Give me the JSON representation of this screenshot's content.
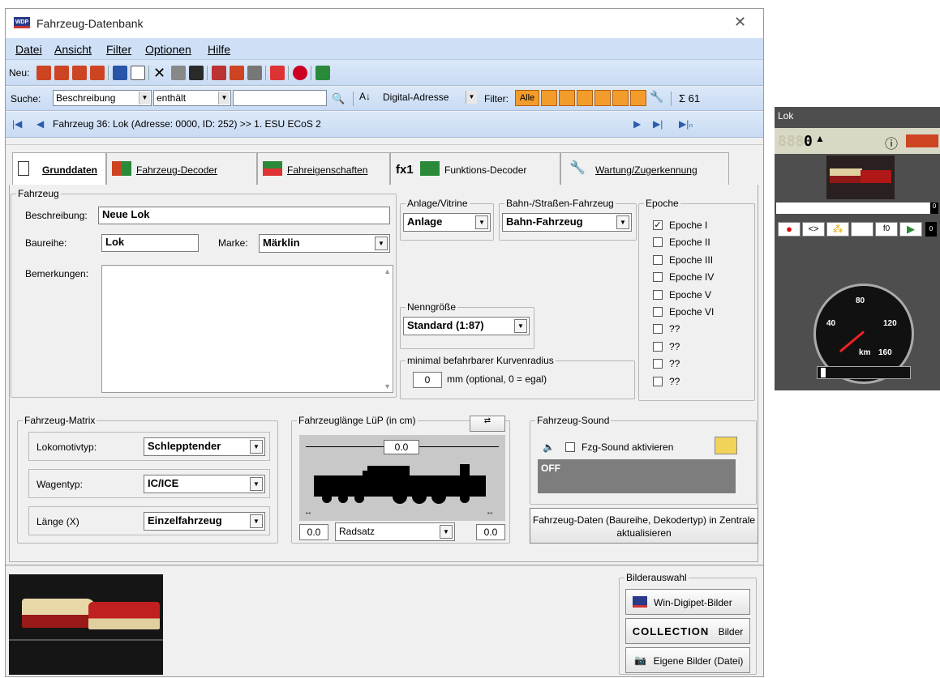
{
  "window": {
    "title": "Fahrzeug-Datenbank",
    "title_icon": "WDP",
    "close": "✕"
  },
  "menu": [
    "Datei",
    "Ansicht",
    "Filter",
    "Optionen",
    "Hilfe"
  ],
  "toolbar": {
    "new_label": "Neu:"
  },
  "search": {
    "label": "Suche:",
    "field": "Beschreibung",
    "op": "enthält",
    "value": "",
    "sort": "Digital-Adresse",
    "filter_label": "Filter:",
    "filter_all": "Alle",
    "sum": "Σ 61"
  },
  "nav": {
    "record": "Fahrzeug 36: Lok (Adresse: 0000, ID: 252) >> 1. ESU ECoS 2"
  },
  "tabs": [
    "Grunddaten",
    "Fahrzeug-Decoder",
    "Fahreigenschaften",
    "Funktions-Decoder",
    "Wartung/Zugerkennung"
  ],
  "tab_prefix_fx": "fx1",
  "fahrzeug": {
    "group": "Fahrzeug",
    "beschreibung_label": "Beschreibung:",
    "beschreibung": "Neue Lok",
    "baureihe_label": "Baureihe:",
    "baureihe": "Lok",
    "marke_label": "Marke:",
    "marke": "Märklin",
    "bemerkungen_label": "Bemerkungen:"
  },
  "anlage": {
    "group": "Anlage/Vitrine",
    "value": "Anlage"
  },
  "bahn": {
    "group": "Bahn-/Straßen-Fahrzeug",
    "value": "Bahn-Fahrzeug"
  },
  "nenngroesse": {
    "group": "Nenngröße",
    "value": "Standard (1:87)"
  },
  "radius": {
    "group": "minimal befahrbarer Kurvenradius",
    "value": "0",
    "unit": "mm (optional, 0 = egal)"
  },
  "epoche": {
    "group": "Epoche",
    "items": [
      {
        "label": "Epoche I",
        "checked": true
      },
      {
        "label": "Epoche II",
        "checked": false
      },
      {
        "label": "Epoche III",
        "checked": false
      },
      {
        "label": "Epoche IV",
        "checked": false
      },
      {
        "label": "Epoche V",
        "checked": false
      },
      {
        "label": "Epoche VI",
        "checked": false
      },
      {
        "label": "??",
        "checked": false
      },
      {
        "label": "??",
        "checked": false
      },
      {
        "label": "??",
        "checked": false
      },
      {
        "label": "??",
        "checked": false
      }
    ]
  },
  "matrix": {
    "group": "Fahrzeug-Matrix",
    "lok_label": "Lokomotivtyp:",
    "lok": "Schlepptender",
    "wagen_label": "Wagentyp:",
    "wagen": "IC/ICE",
    "laenge_label": "Länge (X)",
    "laenge": "Einzelfahrzeug"
  },
  "lup": {
    "group": "Fahrzeuglänge LüP (in cm)",
    "total": "0.0",
    "left": "0.0",
    "right": "0.0",
    "radsatz": "Radsatz"
  },
  "sound": {
    "group": "Fahrzeug-Sound",
    "checkbox": "Fzg-Sound aktivieren",
    "status": "OFF"
  },
  "update_button": "Fahrzeug-Daten (Baureihe, Dekodertyp) in Zentrale aktualisieren",
  "bilder": {
    "group": "Bilderauswahl",
    "btn1": "Win-Digipet-Bilder",
    "btn2_logo": "COLLECTION",
    "btn2": "Bilder",
    "btn3": "Eigene Bilder (Datei)"
  },
  "lok_panel": {
    "title": "Lok",
    "addr": "888",
    "digit": "0",
    "speed_max": "0",
    "gauge_labels": [
      "40",
      "80",
      "120",
      "160"
    ],
    "gauge_unit": "km",
    "f0": "f0"
  }
}
